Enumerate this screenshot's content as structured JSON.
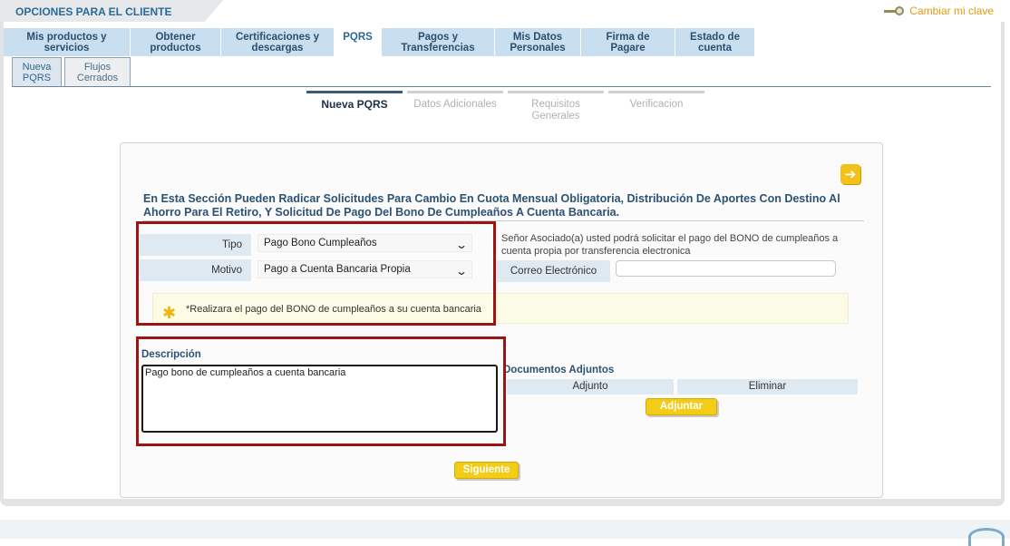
{
  "header": {
    "title": "OPCIONES PARA EL CLIENTE",
    "change_key_label": "Cambiar mi clave"
  },
  "nav": {
    "tabs": [
      {
        "label": "Mis productos y servicios"
      },
      {
        "label": "Obtener productos"
      },
      {
        "label": "Certificaciones y descargas"
      },
      {
        "label": "PQRS"
      },
      {
        "label": "Pagos y Transferencias"
      },
      {
        "label": "Mis Datos Personales"
      },
      {
        "label": "Firma de Pagare"
      },
      {
        "label": "Estado de cuenta"
      }
    ],
    "active_index": 3
  },
  "subtabs": [
    {
      "label": "Nueva PQRS"
    },
    {
      "label": "Flujos Cerrados"
    }
  ],
  "steps": [
    {
      "label": "Nueva PQRS"
    },
    {
      "label": "Datos Adicionales"
    },
    {
      "label": "Requisitos Generales"
    },
    {
      "label": "Verificacion"
    }
  ],
  "form": {
    "headline": "En Esta Sección Pueden Radicar Solicitudes Para Cambio En Cuota Mensual Obligatoria, Distribución De Aportes Con Destino Al Ahorro Para El Retiro, Y Solicitud De Pago Del Bono De Cumpleaños A Cuenta Bancaria.",
    "tipo_label": "Tipo",
    "tipo_value": "Pago Bono Cumpleaños",
    "motivo_label": "Motivo",
    "motivo_value": "Pago a Cuenta Bancaria Propia",
    "info_text": "Señor Asociado(a) usted podrá solicitar el pago del BONO de cumpleaños a cuenta propia por transferencia electronica",
    "email_label": "Correo Electrónico",
    "email_value": "",
    "notice_text": "*Realizara el pago del BONO de cumpleaños a su cuenta bancaria",
    "descripcion_label": "Descripción",
    "descripcion_value": "Pago bono de cumpleaños a cuenta bancaria",
    "docs_label": "Documentos Adjuntos",
    "docs_columns": [
      "Adjunto",
      "Eliminar"
    ],
    "adjuntar_label": "Adjuntar",
    "siguiente_label": "Siguiente"
  },
  "colors": {
    "accent": "#2c5274",
    "tab_bg": "#c9dff0",
    "button": "#f3cc17",
    "highlight": "#9c1414"
  },
  "icons": [
    "key-icon",
    "next-arrow-icon",
    "asterisk-star-icon",
    "chevron-down-icon"
  ]
}
